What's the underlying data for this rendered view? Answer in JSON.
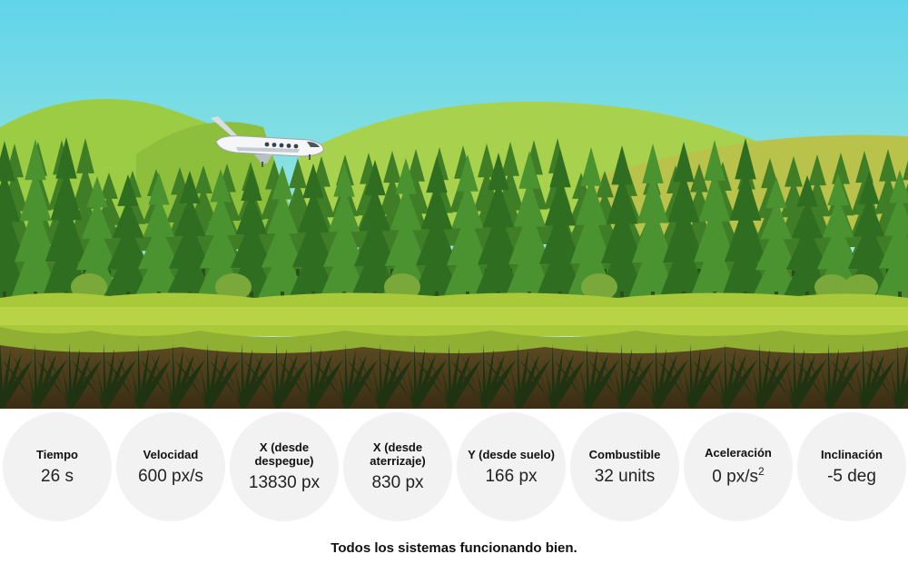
{
  "gauges": [
    {
      "label": "Tiempo",
      "value": "26 s"
    },
    {
      "label": "Velocidad",
      "value": "600 px/s"
    },
    {
      "label": "X (desde despegue)",
      "value": "13830 px"
    },
    {
      "label": "X (desde aterrizaje)",
      "value": "830 px"
    },
    {
      "label": "Y (desde suelo)",
      "value": "166 px"
    },
    {
      "label": "Combustible",
      "value": "32 units"
    },
    {
      "label": "Aceleración",
      "value": "0 px/s",
      "value_sup": "2"
    },
    {
      "label": "Inclinación",
      "value": "-5 deg"
    }
  ],
  "status_message": "Todos los sistemas funcionando bien.",
  "colors": {
    "sky_top": "#5fd6e8",
    "sky_bottom": "#b8f0d8",
    "hill": "#8fc43c",
    "tree_dark": "#2d6b22",
    "tree_light": "#4e9a2e",
    "grass": "#a8c83a",
    "soil": "#4a3a1c",
    "gauge_bg": "#f2f2f2"
  },
  "icons": [
    "airplane-icon"
  ]
}
